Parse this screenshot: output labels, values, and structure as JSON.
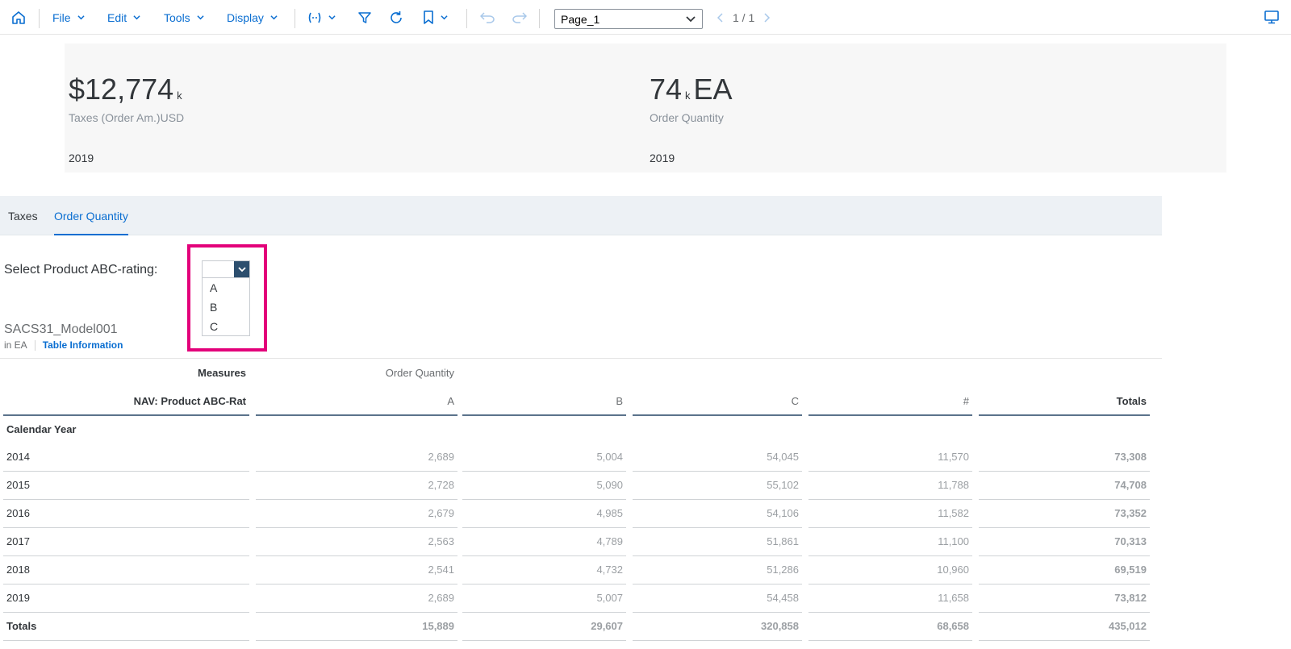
{
  "toolbar": {
    "file": "File",
    "edit": "Edit",
    "tools": "Tools",
    "display": "Display",
    "page_select": "Page_1",
    "pager": "1 / 1",
    "icons": [
      "home-icon",
      "variable-icon",
      "filter-icon",
      "refresh-icon",
      "bookmark-icon",
      "undo-icon",
      "redo-icon",
      "prev-icon",
      "next-icon",
      "monitor-icon"
    ]
  },
  "kpis": [
    {
      "value": "$12,774",
      "scale": "k",
      "unit": "",
      "label": "Taxes (Order Am.)USD",
      "year": "2019"
    },
    {
      "value": "74",
      "scale": "k",
      "unit": "EA",
      "label": "Order Quantity",
      "year": "2019"
    }
  ],
  "tabs": [
    {
      "label": "Taxes",
      "active": false
    },
    {
      "label": "Order Quantity",
      "active": true
    }
  ],
  "filter": {
    "label": "Select Product ABC-rating:",
    "options": [
      "A",
      "B",
      "C"
    ]
  },
  "model": {
    "title": "SACS31_Model001",
    "unit": "in EA",
    "info_link": "Table Information"
  },
  "table": {
    "measures_label": "Measures",
    "measure_name": "Order Quantity",
    "dimension_label": "NAV: Product ABC-Rat",
    "columns": [
      "A",
      "B",
      "C",
      "#",
      "Totals"
    ],
    "row_dimension": "Calendar Year",
    "rows": [
      {
        "label": "2014",
        "values": [
          "2,689",
          "5,004",
          "54,045",
          "11,570",
          "73,308"
        ]
      },
      {
        "label": "2015",
        "values": [
          "2,728",
          "5,090",
          "55,102",
          "11,788",
          "74,708"
        ]
      },
      {
        "label": "2016",
        "values": [
          "2,679",
          "4,985",
          "54,106",
          "11,582",
          "73,352"
        ]
      },
      {
        "label": "2017",
        "values": [
          "2,563",
          "4,789",
          "51,861",
          "11,100",
          "70,313"
        ]
      },
      {
        "label": "2018",
        "values": [
          "2,541",
          "4,732",
          "51,286",
          "10,960",
          "69,519"
        ]
      },
      {
        "label": "2019",
        "values": [
          "2,689",
          "5,007",
          "54,458",
          "11,658",
          "73,812"
        ]
      }
    ],
    "totals": {
      "label": "Totals",
      "values": [
        "15,889",
        "29,607",
        "320,858",
        "68,658",
        "435,012"
      ]
    }
  },
  "colors": {
    "accent": "#0a6ed1",
    "highlight": "#e3007a",
    "dropdown_button": "#2c4e6e",
    "tab_bar": "#edf1f5"
  }
}
